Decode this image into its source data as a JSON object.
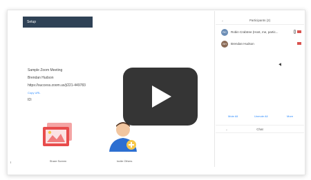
{
  "setup_bar": {
    "label": "Setup"
  },
  "meeting": {
    "topic": "Sample Zoom Meeting",
    "host": "Brendan Hudson",
    "url": "https://success.zoom.us/j/221-449783",
    "copy_link": "Copy URL",
    "participant_id": "ID:"
  },
  "tiles": {
    "share": "Share Screen",
    "invite": "Invite Others"
  },
  "participants_panel": {
    "title": "Participants (2)",
    "items": [
      {
        "name": "Robin Crabtree (Host, me, partic...",
        "initials": "RC"
      },
      {
        "name": "Brendan Hudson",
        "initials": "BH"
      }
    ],
    "actions": {
      "mute_all": "Mute All",
      "unmute_all": "Unmute All",
      "more": "More"
    }
  },
  "chat_panel": {
    "title": "Chat"
  },
  "colors": {
    "setup_bar": "#2f4256",
    "link": "#2d8cff",
    "play_bg": "#141414"
  }
}
